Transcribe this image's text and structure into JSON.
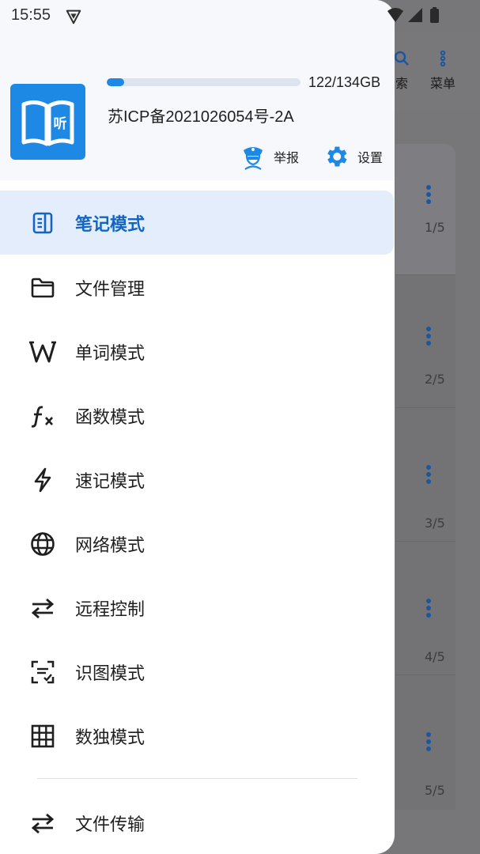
{
  "status_bar": {
    "time": "15:55",
    "icons": [
      "vpn-shield-icon",
      "wifi-icon",
      "signal-icon",
      "battery-icon"
    ]
  },
  "background_app": {
    "toolbar": [
      {
        "label": "索",
        "icon": "search-icon"
      },
      {
        "label": "菜单",
        "icon": "more-vertical-icon"
      }
    ],
    "cards": [
      {
        "count": "1/5"
      },
      {
        "count": "2/5"
      },
      {
        "count": "3/5"
      },
      {
        "count": "4/5"
      },
      {
        "count": "5/5"
      }
    ]
  },
  "drawer": {
    "header": {
      "logo_text": "听",
      "storage_label": "122/134GB",
      "storage_used_fraction": 0.09,
      "icp": "苏ICP备2021026054号-2A",
      "report_label": "举报",
      "settings_label": "设置"
    },
    "menu": [
      {
        "label": "笔记模式",
        "icon": "note-icon",
        "active": true
      },
      {
        "label": "文件管理",
        "icon": "folder-icon",
        "active": false
      },
      {
        "label": "单词模式",
        "icon": "letter-w-icon",
        "active": false
      },
      {
        "label": "函数模式",
        "icon": "function-icon",
        "active": false
      },
      {
        "label": "速记模式",
        "icon": "lightning-icon",
        "active": false
      },
      {
        "label": "网络模式",
        "icon": "globe-icon",
        "active": false
      },
      {
        "label": "远程控制",
        "icon": "swap-arrows-icon",
        "active": false
      },
      {
        "label": "识图模式",
        "icon": "scan-text-icon",
        "active": false
      },
      {
        "label": "数独模式",
        "icon": "grid-icon",
        "active": false
      }
    ],
    "footer_item": {
      "label": "文件传输",
      "icon": "swap-arrows-icon"
    }
  },
  "colors": {
    "accent": "#1e88e5",
    "active_bg": "#e3edfb",
    "active_text": "#1565c0",
    "header_bg": "#f6f8fc"
  }
}
